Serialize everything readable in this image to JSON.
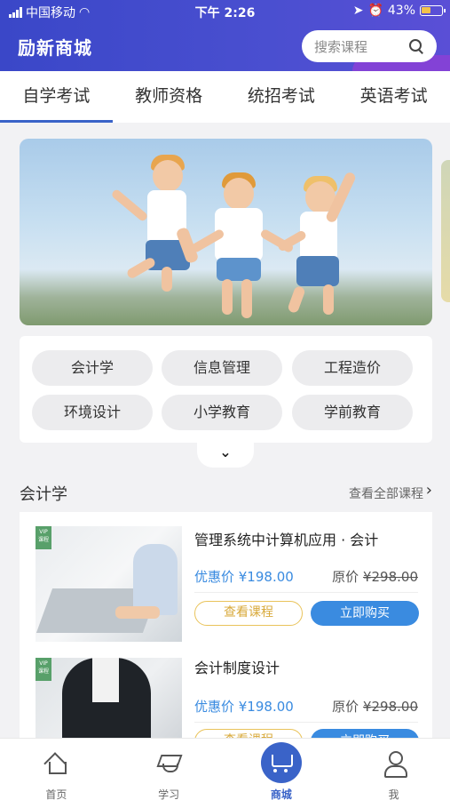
{
  "status_bar": {
    "carrier": "中国移动",
    "time": "下午 2:26",
    "battery": "43%"
  },
  "header": {
    "title": "励新商城",
    "search_placeholder": "搜索课程",
    "icons": {
      "search": "search-icon"
    }
  },
  "tabs": [
    {
      "label": "自学考试",
      "active": true
    },
    {
      "label": "教师资格",
      "active": false
    },
    {
      "label": "统招考试",
      "active": false
    },
    {
      "label": "英语考试",
      "active": false
    }
  ],
  "categories": [
    "会计学",
    "信息管理",
    "工程造价",
    "环境设计",
    "小学教育",
    "学前教育"
  ],
  "section": {
    "title": "会计学",
    "more": "查看全部课程"
  },
  "courses": [
    {
      "title": "管理系统中计算机应用 · 会计",
      "sale_price": "优惠价 ¥198.00",
      "orig_label": "原价",
      "orig_price": "¥298.00",
      "view_label": "查看课程",
      "buy_label": "立即购买"
    },
    {
      "title": "会计制度设计",
      "sale_price": "优惠价 ¥198.00",
      "orig_label": "原价",
      "orig_price": "¥298.00",
      "view_label": "查看课程",
      "buy_label": "立即购买"
    }
  ],
  "bottom_nav": [
    {
      "label": "首页",
      "icon": "home-icon",
      "active": false
    },
    {
      "label": "学习",
      "icon": "graduation-cap-icon",
      "active": false
    },
    {
      "label": "商城",
      "icon": "cart-icon",
      "active": true
    },
    {
      "label": "我",
      "icon": "user-icon",
      "active": false
    }
  ],
  "colors": {
    "header_bg": "#3a47c8",
    "accent_blue": "#3a63c8",
    "price_blue": "#3a8be0",
    "view_button_gold": "#e9c35a"
  }
}
